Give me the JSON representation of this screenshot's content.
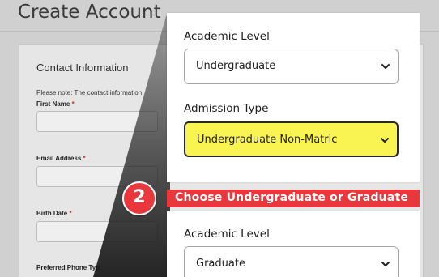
{
  "page": {
    "title": "Create Account",
    "section_title": "Contact Information",
    "note": "Please note: The contact information",
    "fields": [
      {
        "label": "First Name",
        "required_mark": "*"
      },
      {
        "label": "Email Address",
        "required_mark": "*"
      },
      {
        "label": "Birth Date",
        "required_mark": "*"
      },
      {
        "label": "Preferred Phone Typ",
        "required_mark": ""
      }
    ]
  },
  "callout_top": {
    "academic_level_label": "Academic Level",
    "academic_level_value": "Undergraduate",
    "admission_type_label": "Admission Type",
    "admission_type_value": "Undergraduate Non-Matric"
  },
  "step": {
    "number": "2",
    "instruction": "Choose Undergraduate or Graduate"
  },
  "callout_bottom": {
    "academic_level_label": "Academic Level",
    "academic_level_value": "Graduate"
  },
  "colors": {
    "accent_red": "#e8383d",
    "highlight_yellow": "#f9f451"
  },
  "icons": {
    "dropdown": "chevron-down-icon"
  }
}
